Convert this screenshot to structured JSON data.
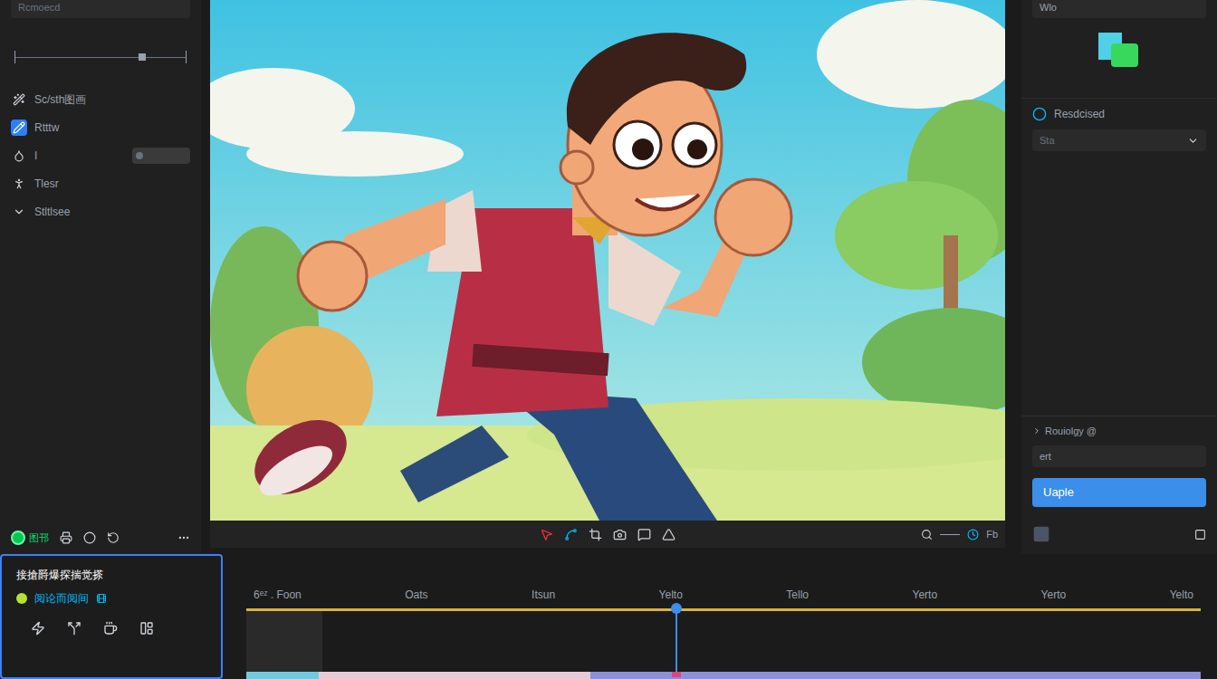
{
  "left_panel": {
    "header": "Rcmoecd",
    "slider": {
      "level": 0.72
    },
    "items": [
      {
        "label": "Sc/sth图画",
        "selected": false,
        "kind": "tool"
      },
      {
        "label": "Rtttw",
        "selected": true,
        "kind": "tool"
      },
      {
        "label": "I",
        "selected": false,
        "kind": "toggle",
        "on": true
      },
      {
        "label": "Tlesr",
        "selected": false,
        "kind": "tool"
      },
      {
        "label": "Stltlsee",
        "selected": false,
        "kind": "tool"
      }
    ],
    "playback_label": "图邗"
  },
  "canvas_toolbar": {
    "zoom_label": "Fb"
  },
  "right_panel": {
    "top_label": "Wlo",
    "section_label": "Resdcised",
    "select_value": "Sta",
    "property_label": "Rouiolgy @",
    "field_value": "ert",
    "button": "Uaple"
  },
  "layers_panel": {
    "title": "接搶爵爆探揣觉搽",
    "row_label": "阅论而阅间"
  },
  "timeline": {
    "ticks": [
      "6ᵉᶻ . Foon",
      "Oats",
      "Itsun",
      "Yelto",
      "Tello",
      "Yerto",
      "Yerto",
      "Yelto"
    ],
    "playhead": {
      "level": 0.45
    },
    "clips": [
      {
        "color": "#6fc9df"
      },
      {
        "color": "#e9c9d6"
      },
      {
        "color": "#8d8fd8"
      }
    ]
  }
}
